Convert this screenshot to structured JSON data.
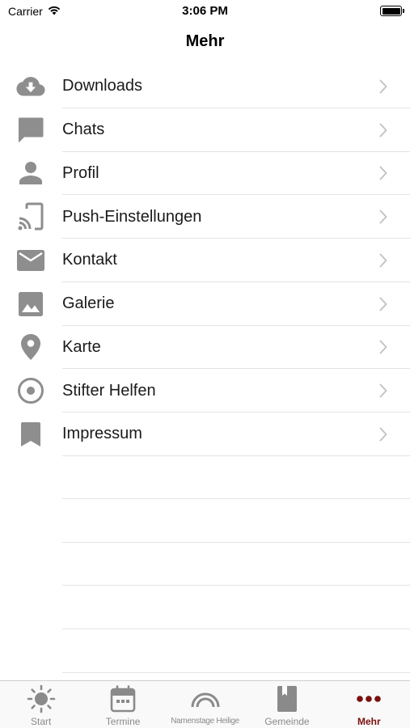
{
  "status_bar": {
    "carrier": "Carrier",
    "time": "3:06 PM"
  },
  "nav": {
    "title": "Mehr"
  },
  "menu": {
    "items": [
      {
        "label": "Downloads",
        "icon": "cloud-download-icon"
      },
      {
        "label": "Chats",
        "icon": "chat-bubble-icon"
      },
      {
        "label": "Profil",
        "icon": "person-icon"
      },
      {
        "label": "Push-Einstellungen",
        "icon": "cast-icon"
      },
      {
        "label": "Kontakt",
        "icon": "mail-icon"
      },
      {
        "label": "Galerie",
        "icon": "image-icon"
      },
      {
        "label": "Karte",
        "icon": "location-pin-icon"
      },
      {
        "label": "Stifter Helfen",
        "icon": "radio-target-icon"
      },
      {
        "label": "Impressum",
        "icon": "bookmark-icon"
      }
    ]
  },
  "tabs": [
    {
      "label": "Start",
      "icon": "sun-icon"
    },
    {
      "label": "Termine",
      "icon": "calendar-icon"
    },
    {
      "label": "Namenstage Heilige",
      "icon": "halo-icon"
    },
    {
      "label": "Gemeinde",
      "icon": "book-icon"
    },
    {
      "label": "Mehr",
      "icon": "more-dots-icon",
      "active": true
    }
  ],
  "colors": {
    "accent": "#7a1010",
    "icon_gray": "#8e8e8e",
    "separator": "#e3e3e3"
  }
}
